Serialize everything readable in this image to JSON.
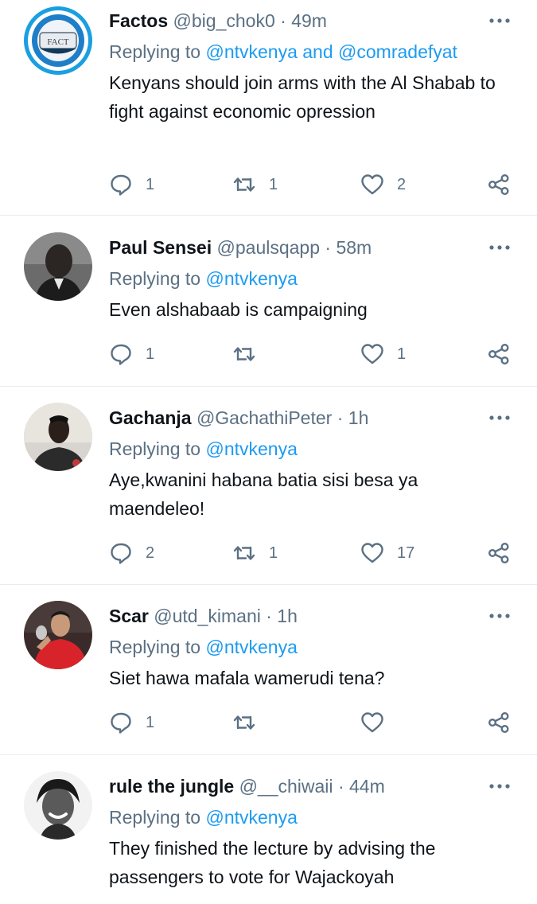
{
  "tweets": [
    {
      "name": "Factos",
      "handle": "@big_chok0",
      "sep": "·",
      "time": "49m",
      "reply_prefix": "Replying to",
      "reply_to": "@ntvkenya and @comradefyat",
      "text": "Kenyans should join arms with the Al Shabab to fight against economic opression",
      "replies": "1",
      "retweets": "1",
      "likes": "2",
      "avatar_text": "FACT"
    },
    {
      "name": "Paul Sensei",
      "handle": "@paulsqapp",
      "sep": "·",
      "time": "58m",
      "reply_prefix": "Replying to",
      "reply_to": "@ntvkenya",
      "text": "Even alshabaab is campaigning",
      "replies": "1",
      "retweets": "",
      "likes": "1"
    },
    {
      "name": "Gachanja",
      "handle": "@GachathiPeter",
      "sep": "·",
      "time": "1h",
      "reply_prefix": "Replying to",
      "reply_to": "@ntvkenya",
      "text": "Aye,kwanini habana batia sisi besa ya maendeleo!",
      "replies": "2",
      "retweets": "1",
      "likes": "17"
    },
    {
      "name": "Scar",
      "handle": "@utd_kimani",
      "sep": "·",
      "time": "1h",
      "reply_prefix": "Replying to",
      "reply_to": "@ntvkenya",
      "text": "Siet hawa mafala wamerudi tena?",
      "replies": "1",
      "retweets": "",
      "likes": ""
    },
    {
      "name": "rule the jungle",
      "handle": "@__chiwaii",
      "sep": "·",
      "time": "44m",
      "reply_prefix": "Replying to",
      "reply_to": "@ntvkenya",
      "text": "They finished the lecture by advising the passengers to vote for Wajackoyah"
    }
  ],
  "colors": {
    "mention": "#1d9bf0",
    "secondary_text": "#5b7083",
    "divider": "#e6ecf0"
  },
  "icons": {
    "reply": "comment-bubble-icon",
    "retweet": "retweet-icon",
    "like": "heart-icon",
    "share": "share-icon",
    "more": "more-dots-icon"
  }
}
